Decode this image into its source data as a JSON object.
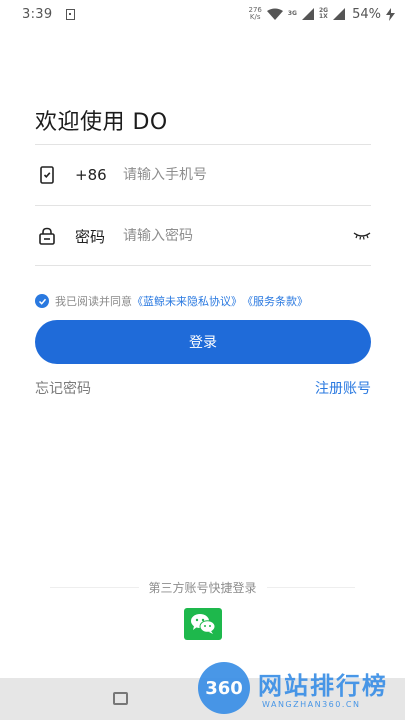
{
  "status_bar": {
    "time": "3:39",
    "speed_value": "276",
    "speed_unit": "K/s",
    "sig1_label": "3G",
    "sig2_label_top": "2G",
    "sig2_label_bottom": "1X",
    "battery": "54%"
  },
  "title": "欢迎使用 DO",
  "phone": {
    "icon": "phone-icon",
    "prefix": "+86",
    "placeholder": "请输入手机号"
  },
  "password": {
    "icon": "lock-icon",
    "label": "密码",
    "placeholder": "请输入密码",
    "toggle_icon": "eye-closed-icon"
  },
  "agreement": {
    "checked": true,
    "text": "我已阅读并同意",
    "privacy_link": "《蓝鲸未来隐私协议》",
    "terms_link": "《服务条款》"
  },
  "login_button": "登录",
  "forgot_password": "忘记密码",
  "register": "注册账号",
  "third_party": {
    "label": "第三方账号快捷登录",
    "icon": "wechat-icon"
  },
  "watermark": {
    "badge": "360",
    "title": "网站排行榜",
    "subtitle": "WANGZHAN360.CN"
  },
  "colors": {
    "accent": "#1f6bd9",
    "link": "#2a79e0",
    "wechat": "#1eb84c"
  }
}
